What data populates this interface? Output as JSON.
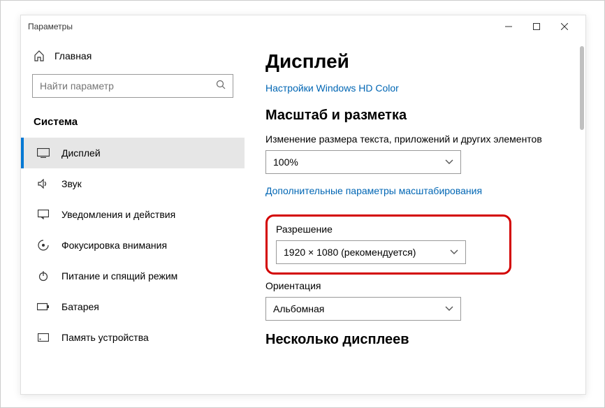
{
  "window": {
    "title": "Параметры"
  },
  "sidebar": {
    "home_label": "Главная",
    "search_placeholder": "Найти параметр",
    "section_label": "Система",
    "items": [
      {
        "label": "Дисплей"
      },
      {
        "label": "Звук"
      },
      {
        "label": "Уведомления и действия"
      },
      {
        "label": "Фокусировка внимания"
      },
      {
        "label": "Питание и спящий режим"
      },
      {
        "label": "Батарея"
      },
      {
        "label": "Память устройства"
      }
    ]
  },
  "main": {
    "title": "Дисплей",
    "hd_color_link": "Настройки Windows HD Color",
    "scale_section": "Масштаб и разметка",
    "scale_label": "Изменение размера текста, приложений и других элементов",
    "scale_value": "100%",
    "scale_advanced_link": "Дополнительные параметры масштабирования",
    "resolution_label": "Разрешение",
    "resolution_value": "1920 × 1080 (рекомендуется)",
    "orientation_label": "Ориентация",
    "orientation_value": "Альбомная",
    "multi_section": "Несколько дисплеев"
  }
}
